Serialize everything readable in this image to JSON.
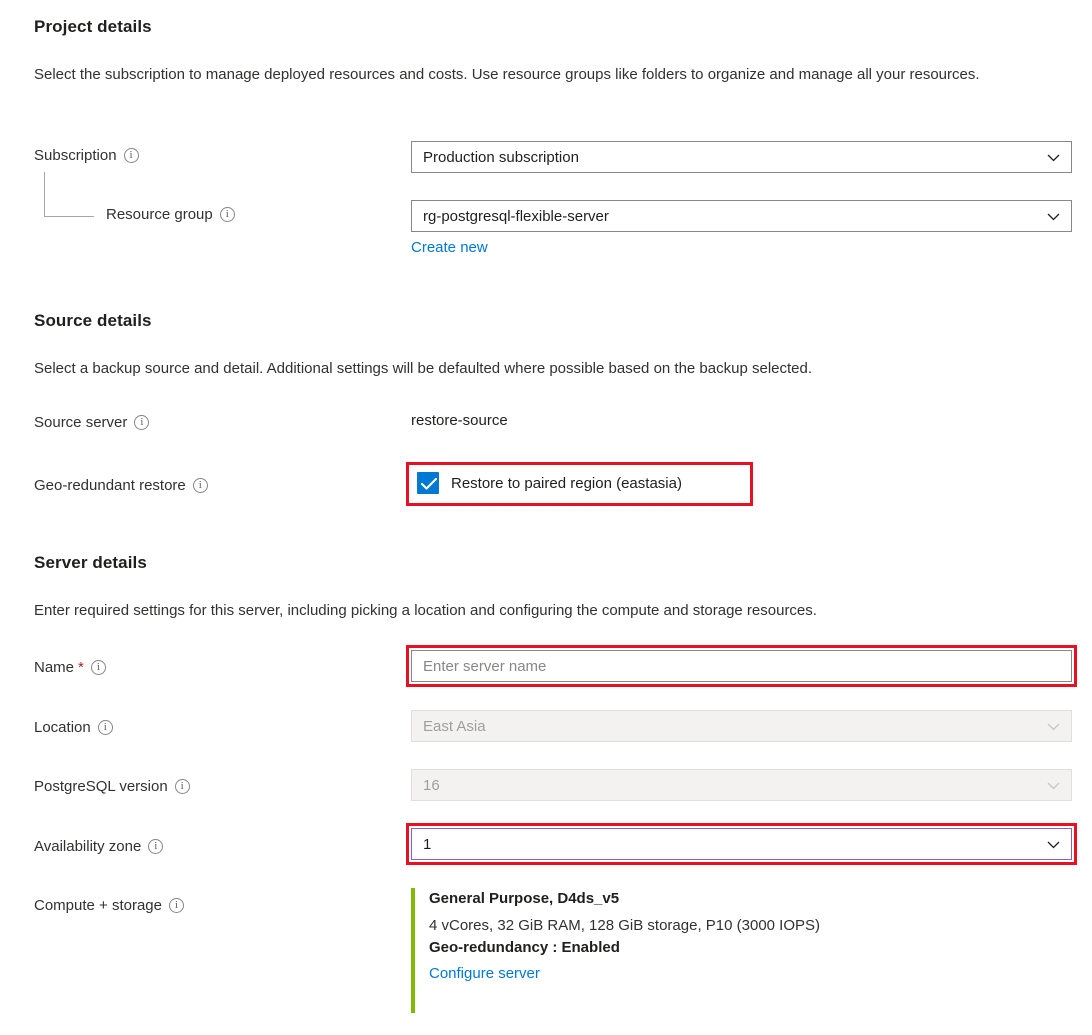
{
  "colors": {
    "accent_blue": "#0078d4",
    "highlight_red": "#e81123",
    "focus_purple": "#8764b8",
    "compute_bar_green": "#7fba00",
    "required_star_red": "#a4262c"
  },
  "sections": {
    "project": {
      "title": "Project details",
      "description": "Select the subscription to manage deployed resources and costs. Use resource groups like folders to organize and manage all your resources.",
      "subscription": {
        "label": "Subscription",
        "value": "Production subscription",
        "info_icon": "info-icon",
        "chevron_icon": "chevron-down-icon"
      },
      "resource_group": {
        "label": "Resource group",
        "value": "rg-postgresql-flexible-server",
        "info_icon": "info-icon",
        "chevron_icon": "chevron-down-icon",
        "create_new_link": "Create new"
      }
    },
    "source": {
      "title": "Source details",
      "description": "Select a backup source and detail. Additional settings will be defaulted where possible based on the backup selected.",
      "source_server": {
        "label": "Source server",
        "value": "restore-source",
        "info_icon": "info-icon"
      },
      "geo_redundant_restore": {
        "label": "Geo-redundant restore",
        "checkbox_label": "Restore to paired region (eastasia)",
        "checked": true,
        "info_icon": "info-icon",
        "check_icon": "checkmark-icon",
        "highlighted": true
      }
    },
    "server": {
      "title": "Server details",
      "description": "Enter required settings for this server, including picking a location and configuring the compute and storage resources.",
      "name": {
        "label": "Name",
        "required_marker": "*",
        "placeholder": "Enter server name",
        "value": "",
        "info_icon": "info-icon",
        "highlighted": true
      },
      "location": {
        "label": "Location",
        "value": "East Asia",
        "disabled": true,
        "info_icon": "info-icon",
        "chevron_icon": "chevron-down-icon"
      },
      "postgresql_version": {
        "label": "PostgreSQL version",
        "value": "16",
        "disabled": true,
        "info_icon": "info-icon",
        "chevron_icon": "chevron-down-icon"
      },
      "availability_zone": {
        "label": "Availability zone",
        "value": "1",
        "info_icon": "info-icon",
        "chevron_icon": "chevron-down-icon",
        "highlighted": true,
        "focused": true
      },
      "compute_storage": {
        "label": "Compute + storage",
        "info_icon": "info-icon",
        "tier": "General Purpose, D4ds_v5",
        "specs": "4 vCores, 32 GiB RAM, 128 GiB storage, P10 (3000 IOPS)",
        "geo_redundancy": "Geo-redundancy : Enabled",
        "configure_link": "Configure server"
      }
    }
  }
}
